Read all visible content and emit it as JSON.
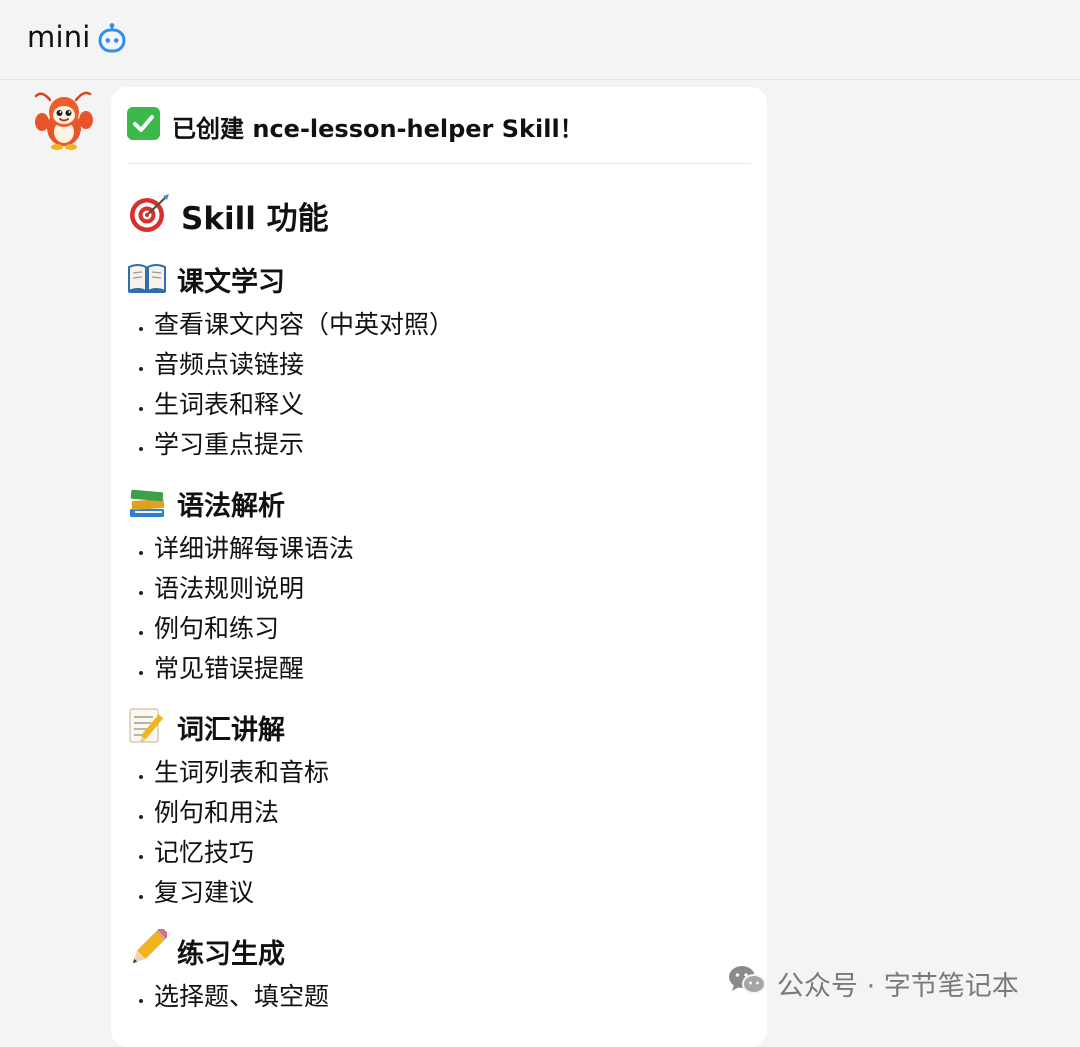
{
  "header": {
    "title": "mini",
    "icon": "robot-icon"
  },
  "chat": {
    "sender_avatar": "lobster-mascot-avatar",
    "message": {
      "status_icon": "check-mark-emoji",
      "title": "已创建 nce-lesson-helper Skill！",
      "heading_icon": "target-emoji",
      "heading": "Skill 功能",
      "sections": [
        {
          "icon": "open-book-emoji",
          "title": "课文学习",
          "items": [
            "查看课文内容（中英对照）",
            "音频点读链接",
            "生词表和释义",
            "学习重点提示"
          ]
        },
        {
          "icon": "books-emoji",
          "title": "语法解析",
          "items": [
            "详细讲解每课语法",
            "语法规则说明",
            "例句和练习",
            "常见错误提醒"
          ]
        },
        {
          "icon": "memo-emoji",
          "title": "词汇讲解",
          "items": [
            "生词列表和音标",
            "例句和用法",
            "记忆技巧",
            "复习建议"
          ]
        },
        {
          "icon": "pencil-emoji",
          "title": "练习生成",
          "items": [
            "选择题、填空题"
          ]
        }
      ]
    }
  },
  "watermark": {
    "icon": "wechat-icon",
    "text": "公众号 · 字节笔记本"
  },
  "colors": {
    "background": "#f4f4f4",
    "bubble": "#ffffff",
    "accent_blue": "#2f8ef5",
    "check_green": "#3cb94a"
  }
}
